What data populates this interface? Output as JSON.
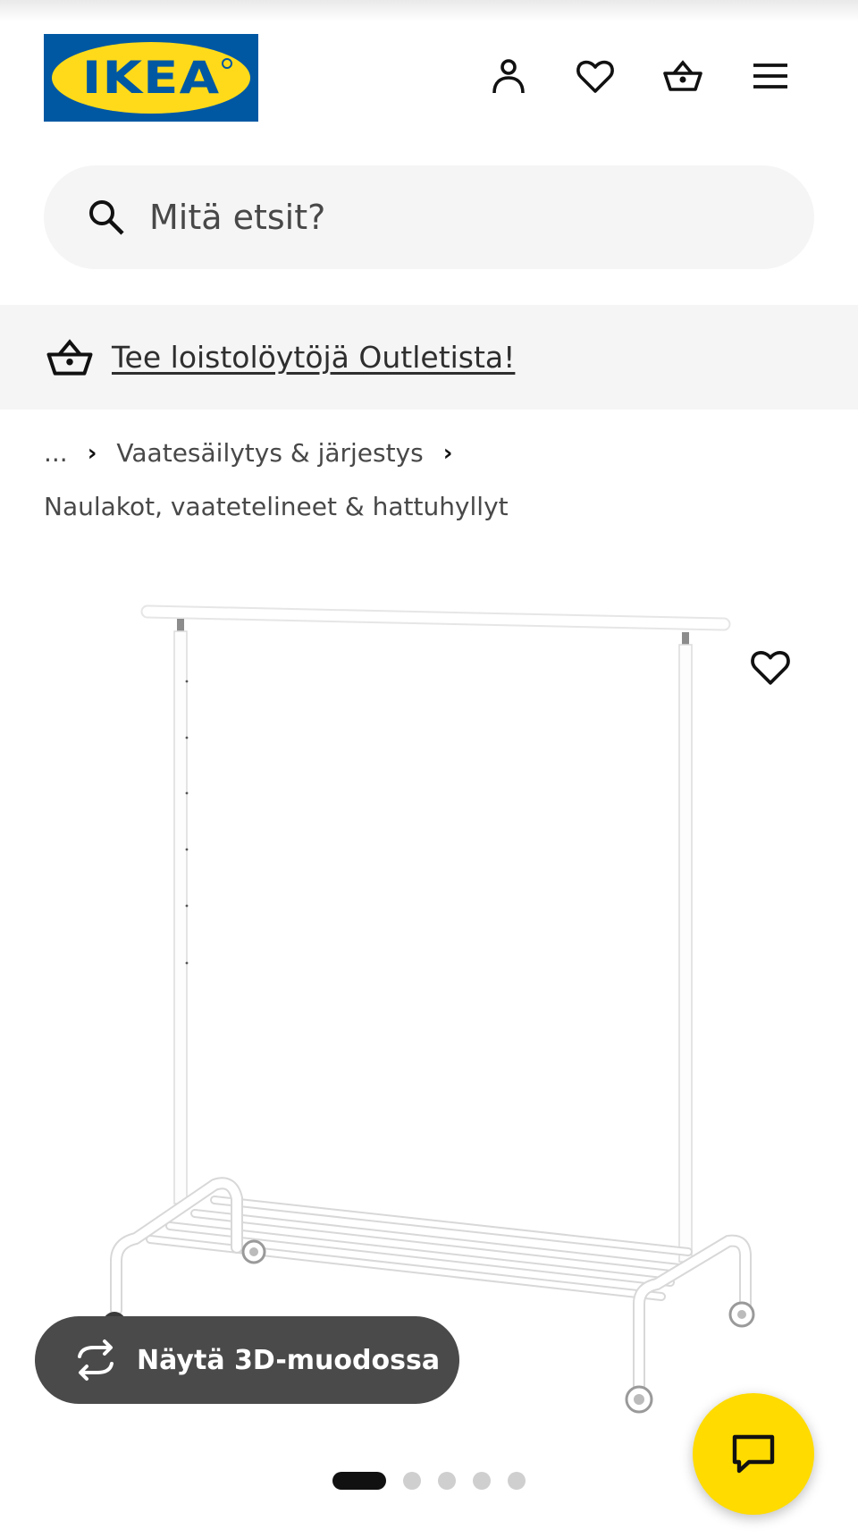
{
  "brand": {
    "logo_text": "IKEA",
    "blue": "#0058a3",
    "yellow": "#ffda1a"
  },
  "header": {
    "icons": [
      "account-icon",
      "heart-icon",
      "basket-icon",
      "menu-icon"
    ]
  },
  "search": {
    "placeholder": "Mitä etsit?"
  },
  "banner": {
    "icon": "basket-icon",
    "link_text": "Tee loistolöytöjä Outletista!"
  },
  "breadcrumb": {
    "ellipsis": "...",
    "level1": "Vaatesäilytys & järjestys",
    "level2": "Naulakot, vaatetelineet & hattuhyllyt"
  },
  "product": {
    "image": "clothes-rack-on-wheels"
  },
  "viewer": {
    "button_label": "Näytä 3D-muodossa"
  },
  "carousel": {
    "total": 5,
    "active_index": 0
  },
  "chat": {
    "icon": "chat-bubble-icon",
    "color": "#ffdb00"
  }
}
